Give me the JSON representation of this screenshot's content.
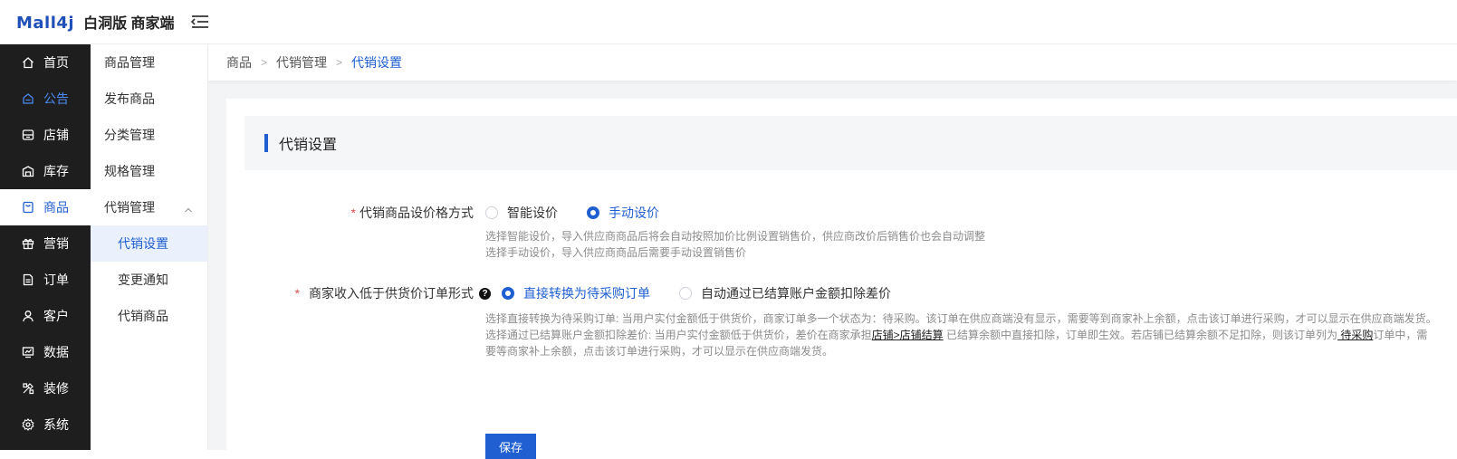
{
  "header": {
    "logo_mark": "Mall4j",
    "logo_text": "白洞版 商家端"
  },
  "colors": {
    "accent": "#1f5fd1",
    "sidebar_bg": "#1e1e1e",
    "required": "#e34d4d"
  },
  "sidebar": {
    "items": [
      {
        "label": "首页",
        "icon": "home-icon"
      },
      {
        "label": "公告",
        "icon": "notice-icon"
      },
      {
        "label": "店铺",
        "icon": "store-icon"
      },
      {
        "label": "库存",
        "icon": "inventory-icon"
      },
      {
        "label": "商品",
        "icon": "goods-icon",
        "active": true
      },
      {
        "label": "营销",
        "icon": "gift-icon"
      },
      {
        "label": "订单",
        "icon": "order-icon"
      },
      {
        "label": "客户",
        "icon": "user-icon"
      },
      {
        "label": "数据",
        "icon": "chart-icon"
      },
      {
        "label": "装修",
        "icon": "decorate-icon"
      },
      {
        "label": "系统",
        "icon": "gear-icon"
      }
    ]
  },
  "submenu": {
    "items": [
      {
        "label": "商品管理"
      },
      {
        "label": "发布商品"
      },
      {
        "label": "分类管理"
      },
      {
        "label": "规格管理"
      },
      {
        "label": "代销管理"
      },
      {
        "label": "代销设置"
      },
      {
        "label": "变更通知"
      },
      {
        "label": "代销商品"
      }
    ]
  },
  "breadcrumb": [
    "商品",
    "代销管理",
    "代销设置"
  ],
  "section_title": "代销设置",
  "form": {
    "pricing": {
      "label": "代销商品设价格方式",
      "options": [
        "智能设价",
        "手动设价"
      ],
      "selected": "手动设价",
      "hint_1": "选择智能设价，导入供应商商品后将会自动按照加价比例设置销售价，供应商改价后销售价也会自动调整",
      "hint_2": "选择手动设价，导入供应商商品后需要手动设置销售价"
    },
    "low_income": {
      "label": "商家收入低于供货价订单形式",
      "help": "?",
      "options": [
        "直接转换为待采购订单",
        "自动通过已结算账户金额扣除差价"
      ],
      "selected": "直接转换为待采购订单",
      "hint_1": "选择直接转换为待采购订单: 当用户实付金额低于供货价，商家订单多一个状态为：待采购。该订单在供应商端没有显示，需要等到商家补上余额，点击该订单进行采购，才可以显示在供应商端发货。",
      "hint_2_a": "选择通过已结算账户金额扣除差价: 当用户实付金额低于供货价，差价在商家承担",
      "hint_2_link1": "店铺>店铺结算",
      "hint_2_b": " 已结算余额中直接扣除，订单即生效。若店铺已结算余额不足扣除，则该订单列为",
      "hint_2_link2": " 待采购",
      "hint_2_c": "订单中，需",
      "hint_3": "要等商家补上余额，点击该订单进行采购，才可以显示在供应商端发货。"
    },
    "save_label": "保存"
  }
}
